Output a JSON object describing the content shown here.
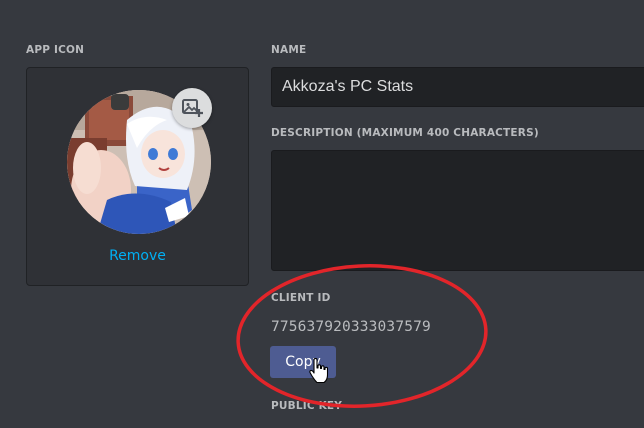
{
  "app_icon": {
    "label": "APP ICON",
    "remove_label": "Remove",
    "upload_icon": "image-plus-icon",
    "avatar_description": "anime-character-avatar"
  },
  "name_field": {
    "label": "NAME",
    "value": "Akkoza's PC Stats"
  },
  "description_field": {
    "label": "DESCRIPTION (MAXIMUM 400 CHARACTERS)",
    "value": ""
  },
  "client_id": {
    "label": "CLIENT ID",
    "value": "775637920333037579",
    "copy_label": "Copy"
  },
  "public_key": {
    "label": "PUBLIC KEY"
  },
  "colors": {
    "background": "#36393f",
    "panel": "#2f3136",
    "input": "#202225",
    "label": "#b9bbbe",
    "link": "#00b0f4",
    "button": "#4e5c92",
    "annotation": "#e2252a"
  },
  "annotation": {
    "shape": "ellipse",
    "color": "#e2252a",
    "target": "client_id"
  },
  "cursor": {
    "type": "hand-pointer-icon"
  }
}
